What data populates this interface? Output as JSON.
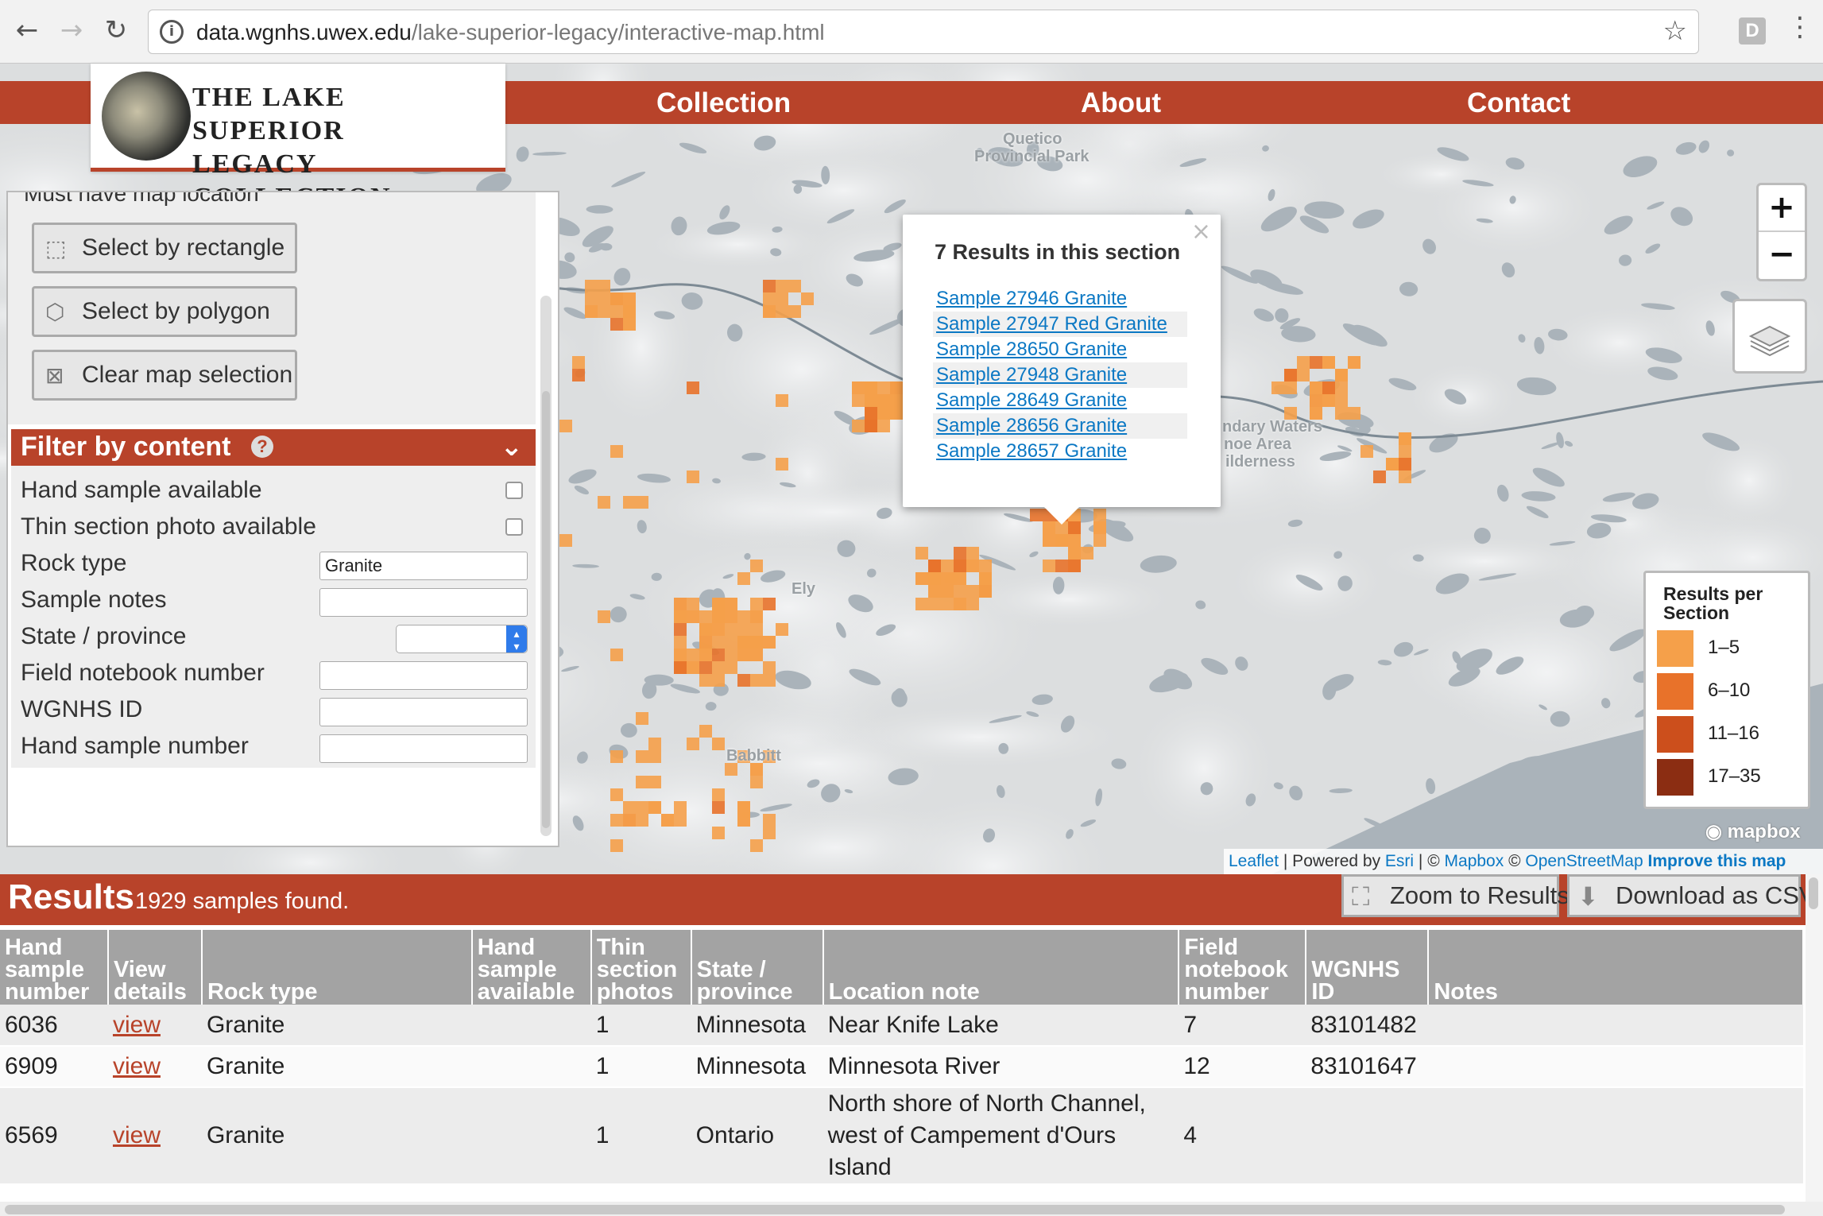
{
  "browser": {
    "url_host": "data.wgnhs.uwex.edu",
    "url_path": "/lake-superior-legacy/interactive-map.html",
    "back_icon": "back-arrow-icon",
    "forward_icon": "forward-arrow-icon",
    "reload_icon": "reload-icon",
    "extension_label": "D"
  },
  "site": {
    "logo_line1": "THE LAKE SUPERIOR",
    "logo_line2": "LEGACY COLLECTION",
    "nav": [
      "Collection",
      "About",
      "Contact"
    ],
    "brand_color": "#b8432a"
  },
  "map": {
    "places": [
      "Quetico",
      "Provincial Park",
      "Ely",
      "Babbitt",
      "ndary Waters",
      "noe Area",
      "ilderness"
    ],
    "mapbox_label": "mapbox",
    "attribution": {
      "leaflet": "Leaflet",
      "powered": " | Powered by ",
      "esri": "Esri",
      "sep": " | © ",
      "mapbox": "Mapbox",
      "osm_prefix": " © ",
      "osm": "OpenStreetMap",
      "improve": " Improve this map"
    },
    "zoom_in": "+",
    "zoom_out": "−",
    "popup": {
      "title": "7 Results in this section",
      "close": "×",
      "links": [
        "Sample 27946 Granite",
        "Sample 27947 Red Granite",
        "Sample 28650 Granite",
        "Sample 27948 Granite",
        "Sample 28649 Granite",
        "Sample 28656 Granite",
        "Sample 28657 Granite"
      ]
    },
    "legend": {
      "title_line1": "Results per",
      "title_line2": "Section",
      "items": [
        {
          "label": "1–5",
          "color": "#f5a04a"
        },
        {
          "label": "6–10",
          "color": "#e8722a"
        },
        {
          "label": "11–16",
          "color": "#cc4f1c"
        },
        {
          "label": "17–35",
          "color": "#8b2d12"
        }
      ]
    }
  },
  "panel": {
    "cut_label": "Must have map location",
    "select_rectangle": "Select by rectangle",
    "select_polygon": "Select by polygon",
    "clear_selection": "Clear map selection",
    "filter_title": "Filter by content",
    "help": "?",
    "chevron": "⌄",
    "fields": {
      "hand_sample": "Hand sample available",
      "thin_section": "Thin section photo available",
      "rock_type": "Rock type",
      "rock_type_value": "Granite",
      "sample_notes": "Sample notes",
      "state": "State / province",
      "field_notebook": "Field notebook number",
      "wgnhs_id": "WGNHS ID",
      "hand_sample_number": "Hand sample number"
    }
  },
  "results": {
    "title": "Results",
    "count": "1929 samples found.",
    "zoom_button": "Zoom to Results",
    "download_button": "Download as CSV",
    "columns": [
      [
        "Hand",
        "sample",
        "number"
      ],
      [
        "View",
        "details"
      ],
      [
        "Rock type"
      ],
      [
        "Hand",
        "sample",
        "available"
      ],
      [
        "Thin",
        "section",
        "photos"
      ],
      [
        "State /",
        "province"
      ],
      [
        "Location note"
      ],
      [
        "Field",
        "notebook",
        "number"
      ],
      [
        "WGNHS",
        "ID"
      ],
      [
        "Notes"
      ]
    ],
    "rows": [
      {
        "hand_sample_number": "6036",
        "view": "view",
        "rock_type": "Granite",
        "available": "",
        "photos": "1",
        "state": "Minnesota",
        "location": "Near Knife Lake",
        "notebook": "7",
        "wgnhs": "83101482",
        "notes": ""
      },
      {
        "hand_sample_number": "6909",
        "view": "view",
        "rock_type": "Granite",
        "available": "",
        "photos": "1",
        "state": "Minnesota",
        "location": "Minnesota River",
        "notebook": "12",
        "wgnhs": "83101647",
        "notes": ""
      },
      {
        "hand_sample_number": "6569",
        "view": "view",
        "rock_type": "Granite",
        "available": "",
        "photos": "1",
        "state": "Ontario",
        "location": "North shore of North Channel, west of Campement d'Ours Island",
        "notebook": "4",
        "wgnhs": "",
        "notes": ""
      }
    ]
  }
}
